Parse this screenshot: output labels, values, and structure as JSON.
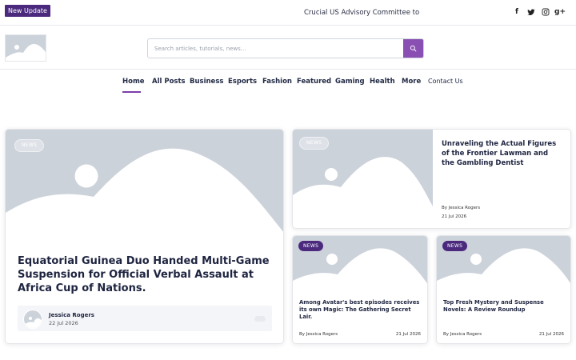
{
  "topbar": {
    "badge": "New Update",
    "ticker": "Crucial US Advisory Committee to Decide",
    "social": [
      {
        "icon": "facebook-icon",
        "glyph": "f"
      },
      {
        "icon": "twitter-icon",
        "glyph": "t"
      },
      {
        "icon": "instagram-icon",
        "glyph": "◎"
      },
      {
        "icon": "google-plus-icon",
        "glyph": "g+"
      }
    ]
  },
  "search": {
    "placeholder": "Search articles, tutorials, news...",
    "button_icon": "search-icon"
  },
  "nav": {
    "items": [
      "Home",
      "All Posts",
      "Business",
      "Esports",
      "Fashion",
      "Featured",
      "Gaming",
      "Health",
      "More",
      "Contact Us"
    ],
    "active": "Home"
  },
  "featured": {
    "tag": "NEWS",
    "title": "Equatorial Guinea Duo Handed Multi-Game Suspension for Official Verbal Assault at Africa Cup of Nations.",
    "author": "Jessica Rogers",
    "date": "22 Jul 2026"
  },
  "side_top": {
    "tag": "NEWS",
    "title": "Unraveling the Actual Figures of the Frontier Lawman and the Gambling Dentist",
    "author": "By Jessica Rogers",
    "date": "21 Jul 2026"
  },
  "small_cards": [
    {
      "tag": "NEWS",
      "title": "Among Avatar's best episodes receives its own Magic: The Gathering Secret Lair.",
      "author": "By Jessica Rogers",
      "date": "21 Jul 2026"
    },
    {
      "tag": "NEWS",
      "title": "Top Fresh Mystery and Suspense Novels: A Review Roundup",
      "author": "By Jessica Rogers",
      "date": "21 Jul 2026"
    }
  ],
  "colors": {
    "accent": "#8a4fb3",
    "badge": "#4b2a7e",
    "placeholder_bg": "#ccd2da"
  }
}
